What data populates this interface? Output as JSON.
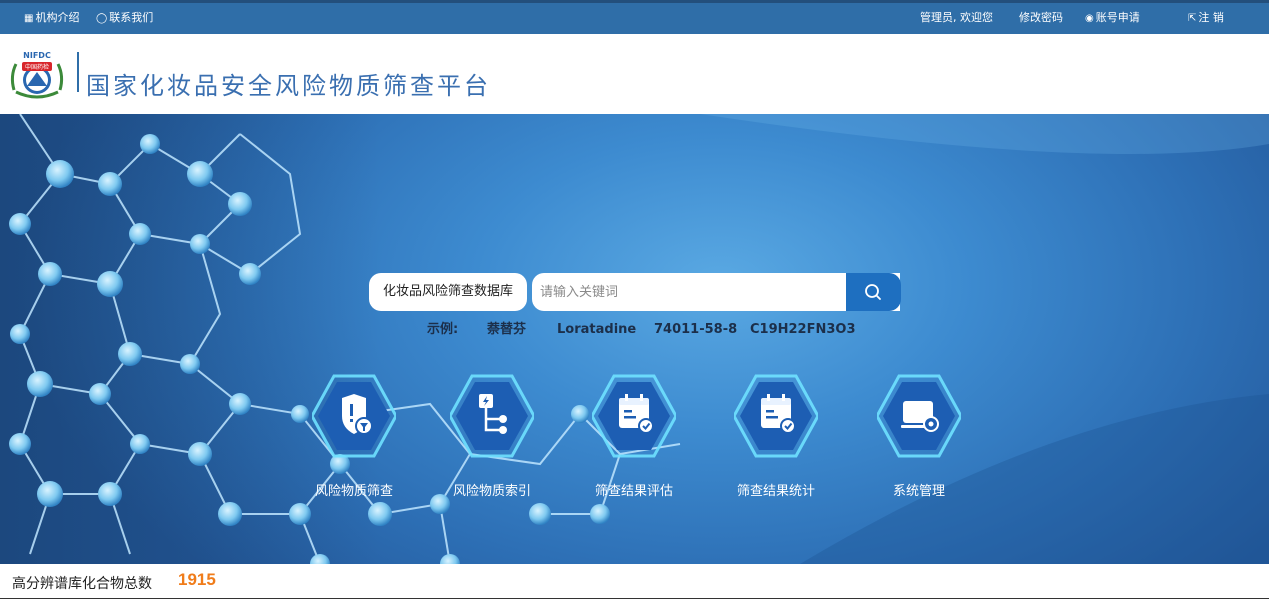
{
  "topbar": {
    "org_intro": "机构介绍",
    "contact": "联系我们",
    "welcome": "管理员, 欢迎您",
    "change_password": "修改密码",
    "account_apply": "账号申请",
    "logout": "注 销"
  },
  "header": {
    "logo_text_top": "NIFDC",
    "logo_text_mid": "中国药检",
    "title": "国家化妆品安全风险物质筛查平台"
  },
  "search": {
    "database": "化妆品风险筛查数据库",
    "placeholder": "请输入关键词",
    "value": ""
  },
  "examples": {
    "label": "示例:",
    "items": [
      "萘替芬",
      "Loratadine",
      "74011-58-8",
      "C19H22FN3O3"
    ]
  },
  "modules": [
    {
      "label": "风险物质筛查",
      "icon": "shield-filter-icon"
    },
    {
      "label": "风险物质索引",
      "icon": "hierarchy-index-icon"
    },
    {
      "label": "筛查结果评估",
      "icon": "calendar-check-icon"
    },
    {
      "label": "筛查结果统计",
      "icon": "calendar-check-icon"
    },
    {
      "label": "系统管理",
      "icon": "monitor-settings-icon"
    }
  ],
  "stats": {
    "label": "高分辨谱库化合物总数",
    "count": "1915"
  },
  "colors": {
    "topbar": "#2f6ea8",
    "accent": "#1e6fc0",
    "count": "#f07c1a"
  }
}
